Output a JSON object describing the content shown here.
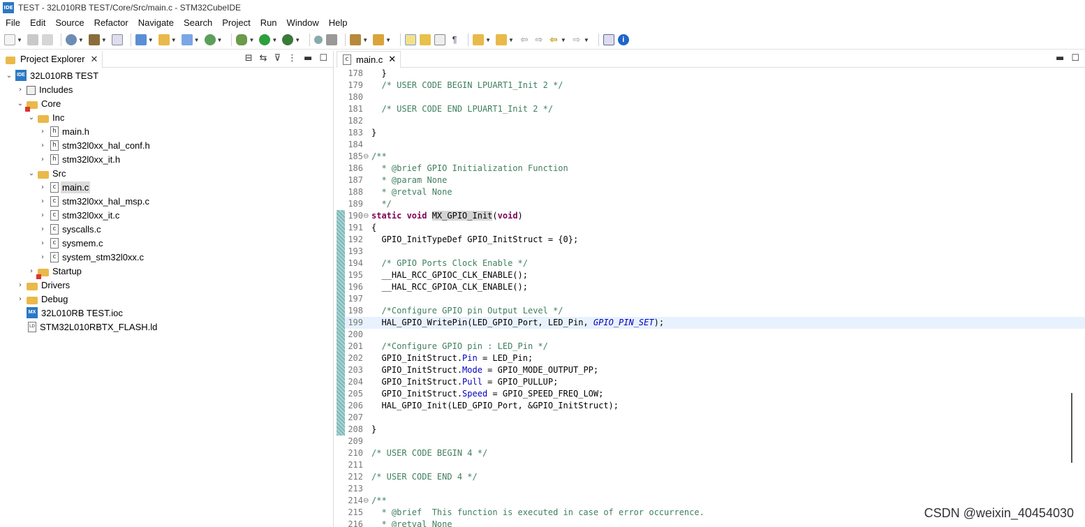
{
  "window": {
    "title": "TEST - 32L010RB TEST/Core/Src/main.c - STM32CubeIDE",
    "icon_text": "IDE"
  },
  "menu": [
    "File",
    "Edit",
    "Source",
    "Refactor",
    "Navigate",
    "Search",
    "Project",
    "Run",
    "Window",
    "Help"
  ],
  "explorer": {
    "tab_label": "Project Explorer",
    "tree": [
      {
        "label": "32L010RB TEST",
        "depth": 0,
        "twist": "⌄",
        "icon": "project"
      },
      {
        "label": "Includes",
        "depth": 1,
        "twist": "›",
        "icon": "includes"
      },
      {
        "label": "Core",
        "depth": 1,
        "twist": "⌄",
        "icon": "source-folder"
      },
      {
        "label": "Inc",
        "depth": 2,
        "twist": "⌄",
        "icon": "folder"
      },
      {
        "label": "main.h",
        "depth": 3,
        "twist": "›",
        "icon": "h-file"
      },
      {
        "label": "stm32l0xx_hal_conf.h",
        "depth": 3,
        "twist": "›",
        "icon": "h-file"
      },
      {
        "label": "stm32l0xx_it.h",
        "depth": 3,
        "twist": "›",
        "icon": "h-file"
      },
      {
        "label": "Src",
        "depth": 2,
        "twist": "⌄",
        "icon": "folder"
      },
      {
        "label": "main.c",
        "depth": 3,
        "twist": "›",
        "icon": "c-file",
        "selected": true
      },
      {
        "label": "stm32l0xx_hal_msp.c",
        "depth": 3,
        "twist": "›",
        "icon": "c-file"
      },
      {
        "label": "stm32l0xx_it.c",
        "depth": 3,
        "twist": "›",
        "icon": "c-file"
      },
      {
        "label": "syscalls.c",
        "depth": 3,
        "twist": "›",
        "icon": "c-file"
      },
      {
        "label": "sysmem.c",
        "depth": 3,
        "twist": "›",
        "icon": "c-file"
      },
      {
        "label": "system_stm32l0xx.c",
        "depth": 3,
        "twist": "›",
        "icon": "c-file"
      },
      {
        "label": "Startup",
        "depth": 2,
        "twist": "›",
        "icon": "source-folder"
      },
      {
        "label": "Drivers",
        "depth": 1,
        "twist": "›",
        "icon": "folder"
      },
      {
        "label": "Debug",
        "depth": 1,
        "twist": "›",
        "icon": "folder"
      },
      {
        "label": "32L010RB TEST.ioc",
        "depth": 1,
        "twist": "",
        "icon": "mx-file"
      },
      {
        "label": "STM32L010RBTX_FLASH.ld",
        "depth": 1,
        "twist": "",
        "icon": "ld-file"
      }
    ]
  },
  "editor": {
    "tab_label": "main.c",
    "lines": [
      {
        "n": "178",
        "t": "  }"
      },
      {
        "n": "179",
        "t": "  /* USER CODE BEGIN LPUART1_Init 2 */",
        "c": true
      },
      {
        "n": "180",
        "t": ""
      },
      {
        "n": "181",
        "t": "  /* USER CODE END LPUART1_Init 2 */",
        "c": true
      },
      {
        "n": "182",
        "t": ""
      },
      {
        "n": "183",
        "t": "}"
      },
      {
        "n": "184",
        "t": ""
      },
      {
        "n": "185",
        "t": "/**",
        "c": true,
        "fold": "⊖"
      },
      {
        "n": "186",
        "t": "  * @brief GPIO Initialization Function",
        "c": true
      },
      {
        "n": "187",
        "t": "  * @param None",
        "c": true
      },
      {
        "n": "188",
        "t": "  * @retval None",
        "c": true
      },
      {
        "n": "189",
        "t": "  */",
        "c": true
      },
      {
        "n": "190",
        "kw1": "static void ",
        "hl": "MX_GPIO_Init",
        "rest": "(",
        "kw2": "void",
        ")": ")",
        "fold": "⊖",
        "q": true
      },
      {
        "n": "191",
        "t": "{",
        "q": true
      },
      {
        "n": "192",
        "t": "  GPIO_InitTypeDef GPIO_InitStruct = {0};",
        "q": true
      },
      {
        "n": "193",
        "t": "",
        "q": true
      },
      {
        "n": "194",
        "t": "  /* GPIO Ports Clock Enable */",
        "c": true,
        "q": true
      },
      {
        "n": "195",
        "t": "  __HAL_RCC_GPIOC_CLK_ENABLE();",
        "q": true
      },
      {
        "n": "196",
        "t": "  __HAL_RCC_GPIOA_CLK_ENABLE();",
        "q": true
      },
      {
        "n": "197",
        "t": "",
        "q": true
      },
      {
        "n": "198",
        "t": "  /*Configure GPIO pin Output Level */",
        "c": true,
        "q": true
      },
      {
        "n": "199",
        "pre": "  HAL_GPIO_WritePin(LED_GPIO_Port, LED_Pin, ",
        "mac": "GPIO_PIN_SET",
        "post": ");",
        "cur": true,
        "q": true
      },
      {
        "n": "200",
        "t": "",
        "q": true
      },
      {
        "n": "201",
        "t": "  /*Configure GPIO pin : LED_Pin */",
        "c": true,
        "q": true
      },
      {
        "n": "202",
        "s": "  GPIO_InitStruct.",
        "f": "Pin",
        "e": " = LED_Pin;",
        "q": true
      },
      {
        "n": "203",
        "s": "  GPIO_InitStruct.",
        "f": "Mode",
        "e": " = GPIO_MODE_OUTPUT_PP;",
        "q": true
      },
      {
        "n": "204",
        "s": "  GPIO_InitStruct.",
        "f": "Pull",
        "e": " = GPIO_PULLUP;",
        "q": true
      },
      {
        "n": "205",
        "s": "  GPIO_InitStruct.",
        "f": "Speed",
        "e": " = GPIO_SPEED_FREQ_LOW;",
        "q": true
      },
      {
        "n": "206",
        "t": "  HAL_GPIO_Init(LED_GPIO_Port, &GPIO_InitStruct);",
        "q": true
      },
      {
        "n": "207",
        "t": "",
        "q": true
      },
      {
        "n": "208",
        "t": "}",
        "q": true
      },
      {
        "n": "209",
        "t": ""
      },
      {
        "n": "210",
        "t": "/* USER CODE BEGIN 4 */",
        "c": true
      },
      {
        "n": "211",
        "t": ""
      },
      {
        "n": "212",
        "t": "/* USER CODE END 4 */",
        "c": true
      },
      {
        "n": "213",
        "t": ""
      },
      {
        "n": "214",
        "t": "/**",
        "c": true,
        "fold": "⊖"
      },
      {
        "n": "215",
        "t": "  * @brief  This function is executed in case of error occurrence.",
        "c": true
      },
      {
        "n": "216",
        "t": "  * @retval None",
        "c": true
      }
    ]
  },
  "watermark": "CSDN @weixin_40454030",
  "colors": {
    "comment": "#3f7f5f",
    "keyword": "#7f0055",
    "field": "#0000c0",
    "current_line": "#e8f2fe"
  }
}
